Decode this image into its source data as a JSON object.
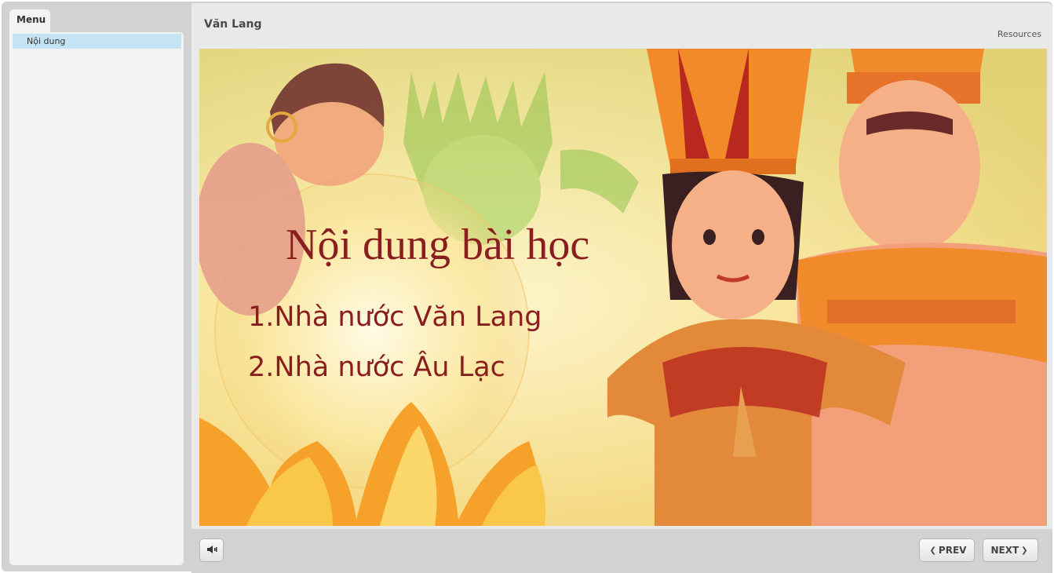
{
  "sidebar": {
    "tab_label": "Menu",
    "items": [
      {
        "label": "Nội dung",
        "selected": true
      }
    ]
  },
  "header": {
    "title": "Văn Lang",
    "resources_label": "Resources"
  },
  "slide": {
    "heading": "Nội dung bài học",
    "items": [
      "1.Nhà nước Văn Lang",
      "2.Nhà nước  Âu Lạc"
    ]
  },
  "controls": {
    "volume_icon": "volume-icon",
    "prev_label": "PREV",
    "next_label": "NEXT",
    "prev_icon": "chevron-left-icon",
    "next_icon": "chevron-right-icon"
  },
  "colors": {
    "accent_selected": "#c4e3f3",
    "slide_text": "#8a1e1e",
    "frame": "#d2d2d2"
  }
}
